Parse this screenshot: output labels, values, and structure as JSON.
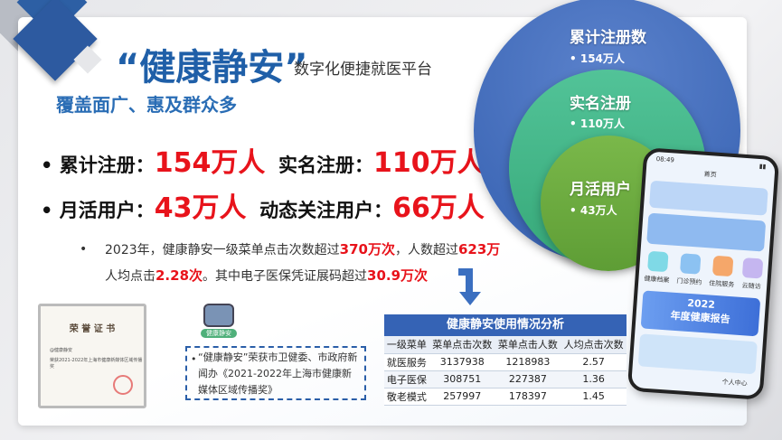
{
  "header": {
    "title": "“健康静安”",
    "subtitle": "数字化便捷就医平台",
    "slogan": "覆盖面广、惠及群众多"
  },
  "stats": [
    {
      "label": "累计注册：",
      "value": "154万人"
    },
    {
      "label": "实名注册：",
      "value": "110万人"
    },
    {
      "label": "月活用户：",
      "value": "43万人"
    },
    {
      "label": "动态关注用户：",
      "value": "66万人"
    }
  ],
  "paragraph": {
    "p1": "2023年，健康静安一级菜单点击次数超过",
    "v1": "370万次",
    "p2": "，人数超过",
    "v2": "623万",
    "p3": "人均点击",
    "v3": "2.28次",
    "p4": "。其中电子医保凭证展码超过",
    "v4": "30.9万次"
  },
  "circles": [
    {
      "label": "累计注册数",
      "value": "• 154万人",
      "color": "#3f66b8"
    },
    {
      "label": "实名注册",
      "value": "• 110万人",
      "color": "#45b78d"
    },
    {
      "label": "月活用户",
      "value": "• 43万人",
      "color": "#6aaa3f"
    }
  ],
  "table": {
    "title": "健康静安使用情况分析",
    "headers": [
      "一级菜单",
      "菜单点击次数",
      "菜单点击人数",
      "人均点击次数"
    ],
    "rows": [
      [
        "就医服务",
        "3137938",
        "1218983",
        "2.57"
      ],
      [
        "电子医保",
        "308751",
        "227387",
        "1.36"
      ],
      [
        "敬老模式",
        "257997",
        "178397",
        "1.45"
      ]
    ]
  },
  "certificate": {
    "title": "荣 誉 证 书",
    "line1": "@健康静安",
    "line2": "荣获2021-2022年上海市健康新媒体区域传播奖"
  },
  "mascot": {
    "text": "健康静安"
  },
  "award": {
    "bullet": "•",
    "text": "“健康静安”荣获市卫健委、市政府新闻办《2021-2022年上海市健康新媒体区域传播奖》"
  },
  "phone": {
    "time": "08:49",
    "title": "首页",
    "icons": [
      "健康档案",
      "门诊预约",
      "住院服务",
      "云随访"
    ],
    "banner_year": "2022",
    "banner_text": "年度健康报告",
    "tab": "个人中心"
  }
}
